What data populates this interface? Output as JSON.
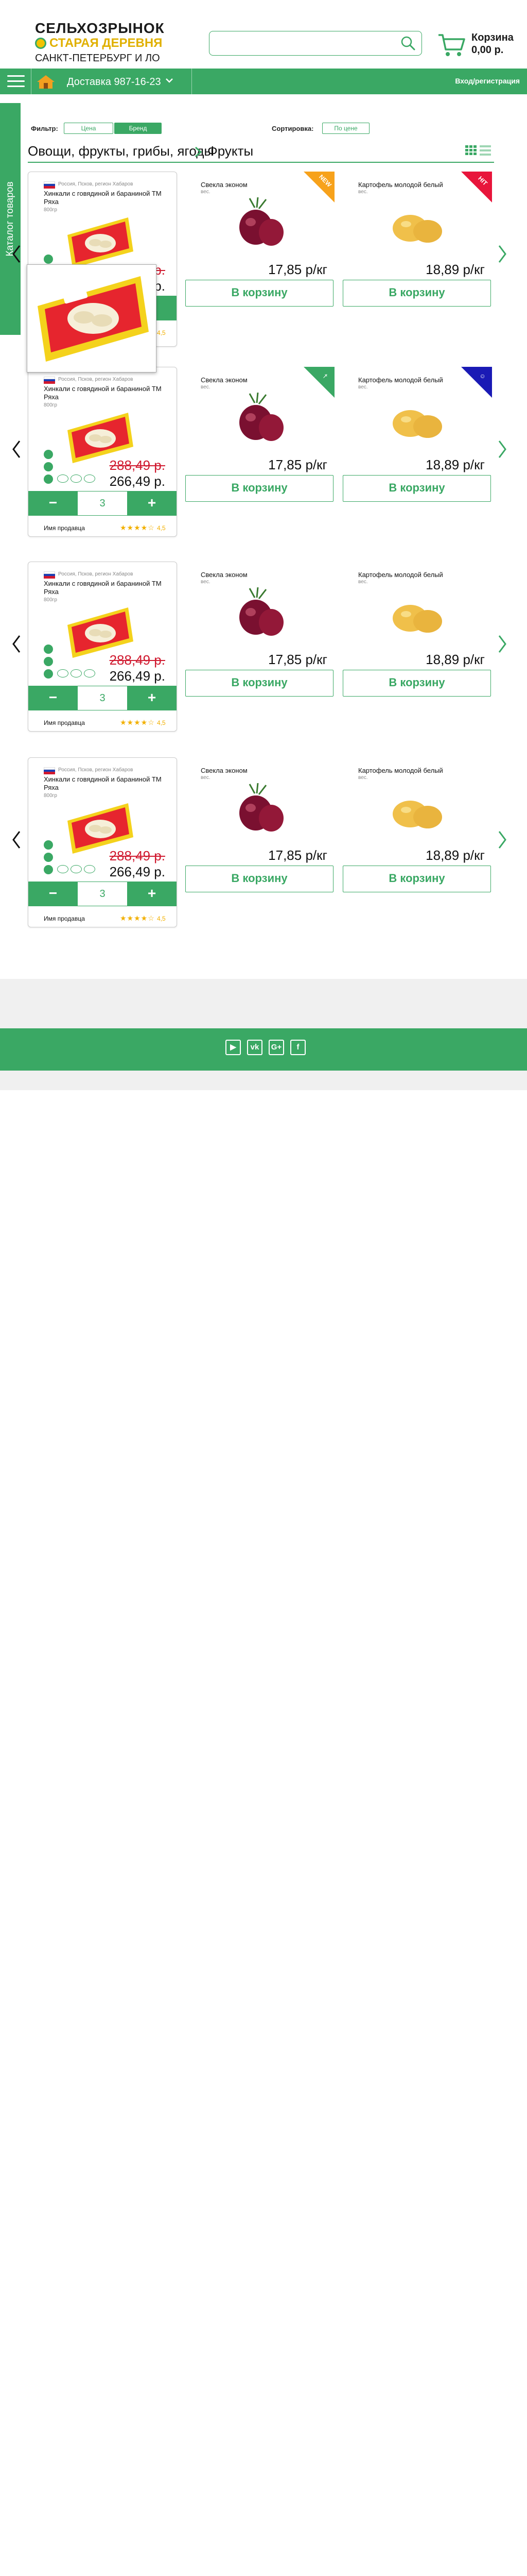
{
  "header": {
    "logo_line1": "СЕЛЬХОЗРЫНОК",
    "logo_line2": "СТАРАЯ ДЕРЕВНЯ",
    "logo_line3": "САНКТ-ПЕТЕРБУРГ И ЛО",
    "search_placeholder": "",
    "cart_label": "Корзина",
    "cart_total": "0,00 р."
  },
  "nav": {
    "delivery": "Доставка 987-16-23",
    "login": "Вход/регистрация"
  },
  "catalog_tab": "Каталог товаров",
  "filter": {
    "filter_label": "Фильтр:",
    "price_btn": "Цена",
    "brand_btn": "Бренд",
    "sort_label": "Сортировка:",
    "sort_btn": "По цене"
  },
  "breadcrumb": {
    "level1": "Овощи, фрукты, грибы, ягоды",
    "level2": "Фрукты"
  },
  "main_product": {
    "origin": "Россия, Псков, регион Хабаров",
    "name": "Хинкали с говядиной и бараниной ТМ Ряха",
    "weight": "800гр",
    "old_price": "288,49 р.",
    "new_price": "266,49 р.",
    "minus": "−",
    "qty": "3",
    "plus": "+",
    "seller": "Имя продавца",
    "stars": "★★★★☆",
    "rating": "4,5"
  },
  "side_products": [
    {
      "name": "Свекла эконом",
      "weight": "вес.",
      "price": "17,85 р/кг",
      "to_cart": "В корзину"
    },
    {
      "name": "Картофель молодой белый",
      "weight": "вес.",
      "price": "18,89 р/кг",
      "to_cart": "В корзину"
    }
  ],
  "ribbons": [
    {
      "row": 0,
      "card": 0,
      "color": "#f7a21b",
      "text": "NEW"
    },
    {
      "row": 0,
      "card": 1,
      "color": "#e8153b",
      "text": "HIT"
    },
    {
      "row": 1,
      "card": 0,
      "color": "#3aa864",
      "text": "†"
    },
    {
      "row": 1,
      "card": 1,
      "color": "#1a1ab5",
      "text": "☺"
    }
  ],
  "footer": {
    "socials": [
      "▶",
      "vk",
      "G+",
      "f"
    ]
  },
  "colors": {
    "brand_green": "#3aa864",
    "price_red": "#d0192f",
    "star_yellow": "#f2b000"
  }
}
